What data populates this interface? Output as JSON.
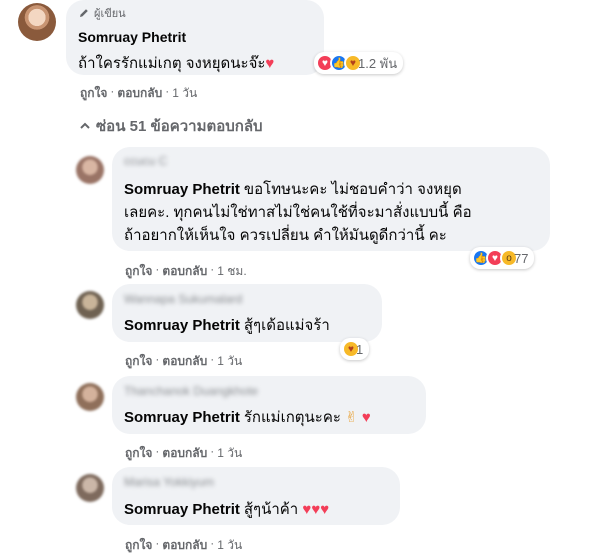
{
  "main_comment": {
    "author_badge": "ผู้เขียน",
    "author": "Somruay Phetrit",
    "text": "ถ้าใครรักแม่เกตุ จงหยุดนะจ๊ะ",
    "reaction_count": "1.2 พัน",
    "actions": {
      "like": "ถูกใจ",
      "reply": "ตอบกลับ",
      "time": "1 วัน"
    }
  },
  "hide_replies": {
    "label": "ซ่อน 51 ข้อความตอบกลับ"
  },
  "replies": [
    {
      "blurred_name": "ccucu  C",
      "author": "Somruay Phetrit",
      "lines": [
        "ขอโทษนะคะ ไม่ชอบคำว่า จงหยุด",
        "เลยคะ. ทุกคนไม่ใช่ทาสไม่ใช่คนใช้ที่จะมาสั่งแบบนี้ คือ",
        "ถ้าอยากให้เห็นใจ ควรเปลี่ยน คำให้มันดูดีกว่านี้ คะ"
      ],
      "reaction_count": "77",
      "actions": {
        "like": "ถูกใจ",
        "reply": "ตอบกลับ",
        "time": "1 ชม."
      }
    },
    {
      "blurred_name": "Wannapa Sukumalard",
      "author": "Somruay Phetrit",
      "text": "สู้ๆเด้อแม่จร้า",
      "reaction_count": "1",
      "actions": {
        "like": "ถูกใจ",
        "reply": "ตอบกลับ",
        "time": "1 วัน"
      }
    },
    {
      "blurred_name": "Thanchanok Duangkhote",
      "author": "Somruay Phetrit",
      "text": "รักแม่เกตุนะคะ",
      "actions": {
        "like": "ถูกใจ",
        "reply": "ตอบกลับ",
        "time": "1 วัน"
      }
    },
    {
      "blurred_name": "Marisa Yokkiyum",
      "author": "Somruay Phetrit",
      "text": "สู้ๆน้าค้า",
      "actions": {
        "like": "ถูกใจ",
        "reply": "ตอบกลับ",
        "time": "1 วัน"
      }
    }
  ],
  "colors": {
    "bubble": "#f0f2f5",
    "meta": "#65676b",
    "like": "#1877f2",
    "love": "#f33e58"
  }
}
